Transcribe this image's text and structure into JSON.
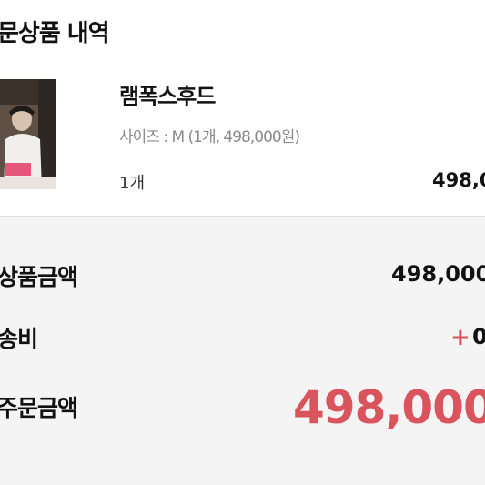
{
  "section": {
    "title": "문상품 내역"
  },
  "product": {
    "name": "램폭스후드",
    "option": "사이즈 : M (1개, 498,000원)",
    "quantity": "1개",
    "price": "498,0"
  },
  "summary": {
    "subtotal_label": "상품금액",
    "subtotal_value": "498,000",
    "shipping_label": "송비",
    "shipping_sign": "+",
    "shipping_value": "0",
    "total_label": "주문금액",
    "total_value": "498,000"
  },
  "colors": {
    "accent": "#d9545c",
    "summary_background": "#f4f4f4",
    "muted_text": "#8a8a8a"
  }
}
